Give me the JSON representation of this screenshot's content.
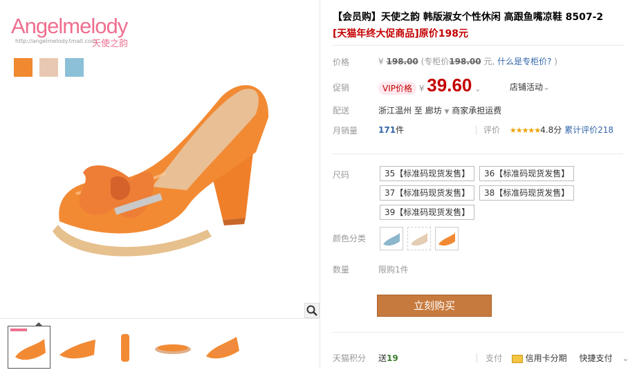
{
  "brand": {
    "name": "Angelmelody",
    "url": "http://angelmelody.tmall.com",
    "cn": "天使之韵"
  },
  "swatches": [
    "#f0892f",
    "#e8c8b2",
    "#8cc0d8"
  ],
  "product": {
    "title": "【会员购】天使之韵 韩版淑女个性休闲 高跟鱼嘴凉鞋 8507-2",
    "promo": "[天猫年终大促商品]原价198元"
  },
  "price": {
    "label": "价格",
    "currency": "¥",
    "original": "198.00",
    "counter_prefix": "(专柜价",
    "counter_value": "198.00",
    "counter_suffix": "元,",
    "counter_link": "什么是专柜价?",
    "counter_close": ")"
  },
  "promo_price": {
    "label": "促销",
    "vip": "VIP价格",
    "currency": "¥",
    "value": "39.60",
    "store_activity": "店铺活动"
  },
  "shipping": {
    "label": "配送",
    "from": "浙江温州",
    "to_word": "至",
    "dest": "廊坊",
    "fee": "商家承担运费"
  },
  "sales": {
    "label": "月销量",
    "count": "171",
    "unit": "件",
    "rating_label": "评价",
    "stars": "★★★★★",
    "score": "4.8分",
    "reviews": "累计评价218"
  },
  "sizes": {
    "label": "尺码",
    "options": [
      "35【标准码现货发售】",
      "36【标准码现货发售】",
      "37【标准码现货发售】",
      "38【标准码现货发售】",
      "39【标准码现货发售】"
    ]
  },
  "colors": {
    "label": "颜色分类",
    "options": [
      "blue-shoe",
      "beige-shoe",
      "orange-shoe"
    ]
  },
  "quantity": {
    "label": "数量",
    "limit": "限购1件"
  },
  "buy_button": "立刻购买",
  "footer": {
    "points_label": "天猫积分",
    "points_prefix": "送",
    "points_value": "19",
    "pay_label": "支付",
    "credit_card": "信用卡分期",
    "quick_pay": "快捷支付"
  }
}
